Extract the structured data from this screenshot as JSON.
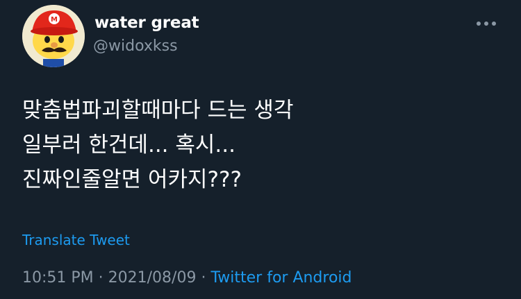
{
  "colors": {
    "background": "#15202b",
    "text_primary": "#ffffff",
    "text_secondary": "#8b98a5",
    "link": "#1d9bf0"
  },
  "author": {
    "display_name": "water great",
    "handle": "@widoxkss",
    "avatar_icon": "mario-hat-avatar"
  },
  "menu": {
    "icon": "more-horizontal-icon"
  },
  "tweet": {
    "text": "맞춤법파괴할때마다 드는 생각\n일부러 한건데... 혹시...\n진짜인줄알면 어카지???",
    "translate_label": "Translate Tweet",
    "time": "10:51 PM",
    "separator": "·",
    "date": "2021/08/09",
    "source": "Twitter for Android"
  }
}
